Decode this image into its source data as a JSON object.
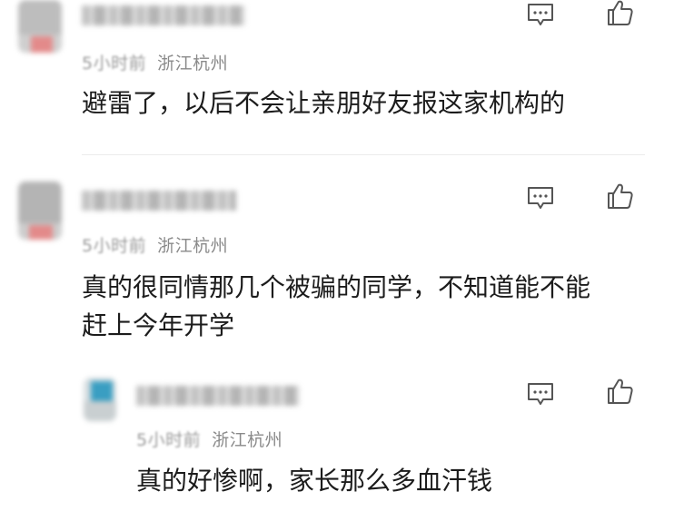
{
  "comments": [
    {
      "time": "5小时前",
      "location": "浙江杭州",
      "lines": [
        "避雷了，以后不会让亲朋好友报这家机构的"
      ]
    },
    {
      "time": "5小时前",
      "location": "浙江杭州",
      "lines": [
        "真的很同情那几个被骗的同学，不知道能不能",
        "赶上今年开学"
      ]
    },
    {
      "time": "5小时前",
      "location": "浙江杭州",
      "lines": [
        "真的好惨啊，家长那么多血汗钱"
      ]
    }
  ],
  "icons": {
    "reply": "comment-icon",
    "like": "thumbs-up-icon"
  },
  "colors": {
    "text": "#1c1c1c",
    "meta": "#8a8a8a",
    "icon": "#555555",
    "divider": "#ececec"
  }
}
